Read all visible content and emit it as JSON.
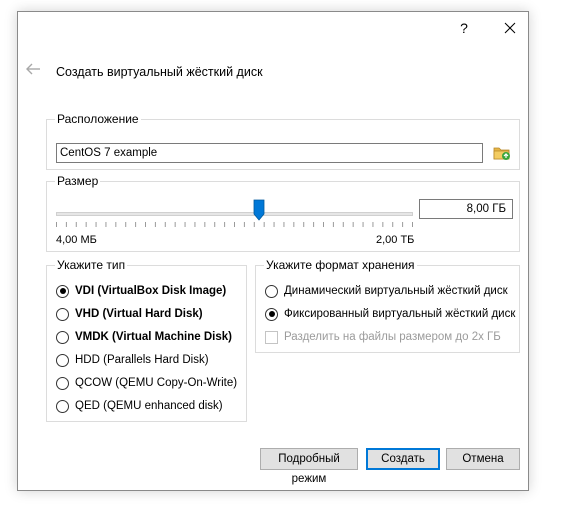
{
  "titlebar": {
    "help_label": "?"
  },
  "wizard": {
    "title": "Создать виртуальный жёсткий диск"
  },
  "location": {
    "group_label": "Расположение",
    "value": "CentOS 7 example"
  },
  "size": {
    "group_label": "Размер",
    "value": "8,00 ГБ",
    "min_label": "4,00 МБ",
    "max_label": "2,00 ТБ",
    "slider_position": 0.57
  },
  "disk_type": {
    "group_label": "Укажите тип",
    "options": [
      {
        "label": "VDI (VirtualBox Disk Image)",
        "checked": true,
        "bold": true
      },
      {
        "label": "VHD (Virtual Hard Disk)",
        "checked": false,
        "bold": true
      },
      {
        "label": "VMDK (Virtual Machine Disk)",
        "checked": false,
        "bold": true
      },
      {
        "label": "HDD (Parallels Hard Disk)",
        "checked": false,
        "bold": false
      },
      {
        "label": "QCOW (QEMU Copy-On-Write)",
        "checked": false,
        "bold": false
      },
      {
        "label": "QED (QEMU enhanced disk)",
        "checked": false,
        "bold": false
      }
    ]
  },
  "storage_format": {
    "group_label": "Укажите формат хранения",
    "options": [
      {
        "label": "Динамический виртуальный жёсткий диск",
        "checked": false
      },
      {
        "label": "Фиксированный виртуальный жёсткий диск",
        "checked": true
      }
    ],
    "split_label": "Разделить на файлы размером до 2х ГБ",
    "split_checked": false,
    "split_enabled": false
  },
  "buttons": {
    "expert": "Подробный режим",
    "create": "Создать",
    "cancel": "Отмена"
  },
  "colors": {
    "slider_handle": "#0078d7",
    "default_button_border": "#0078d7",
    "folder_icon": "#e6b545"
  }
}
